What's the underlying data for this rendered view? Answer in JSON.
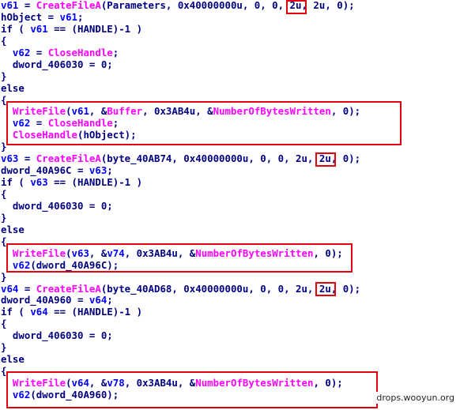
{
  "code_lines": [
    [
      {
        "t": "v61",
        "c": "v"
      },
      {
        "t": " = ",
        "c": "k"
      },
      {
        "t": "CreateFileA",
        "c": "f"
      },
      {
        "t": "(Parameters, 0x40000000u, 0, 0, 2u, 2u, 0);",
        "c": "k"
      }
    ],
    [
      {
        "t": "hObject = ",
        "c": "k"
      },
      {
        "t": "v61",
        "c": "v"
      },
      {
        "t": ";",
        "c": "k"
      }
    ],
    [
      {
        "t": "if ( ",
        "c": "k"
      },
      {
        "t": "v61",
        "c": "v"
      },
      {
        "t": " == (HANDLE)-1 )",
        "c": "k"
      }
    ],
    [
      {
        "t": "{",
        "c": "k"
      }
    ],
    [
      {
        "t": "  ",
        "c": "k"
      },
      {
        "t": "v62",
        "c": "v"
      },
      {
        "t": " = ",
        "c": "k"
      },
      {
        "t": "CloseHandle",
        "c": "f"
      },
      {
        "t": ";",
        "c": "k"
      }
    ],
    [
      {
        "t": "  dword_406030 = 0;",
        "c": "k"
      }
    ],
    [
      {
        "t": "}",
        "c": "k"
      }
    ],
    [
      {
        "t": "else",
        "c": "k"
      }
    ],
    [
      {
        "t": "{",
        "c": "k"
      }
    ],
    [
      {
        "t": "  ",
        "c": "k"
      },
      {
        "t": "WriteFile",
        "c": "f"
      },
      {
        "t": "(",
        "c": "k"
      },
      {
        "t": "v61",
        "c": "v"
      },
      {
        "t": ", &",
        "c": "k"
      },
      {
        "t": "Buffer",
        "c": "f"
      },
      {
        "t": ", 0x3AB4u, &",
        "c": "k"
      },
      {
        "t": "NumberOfBytesWritten",
        "c": "f"
      },
      {
        "t": ", 0);",
        "c": "k"
      }
    ],
    [
      {
        "t": "  ",
        "c": "k"
      },
      {
        "t": "v62",
        "c": "v"
      },
      {
        "t": " = ",
        "c": "k"
      },
      {
        "t": "CloseHandle",
        "c": "f"
      },
      {
        "t": ";",
        "c": "k"
      }
    ],
    [
      {
        "t": "  ",
        "c": "k"
      },
      {
        "t": "CloseHandle",
        "c": "f"
      },
      {
        "t": "(hObject);",
        "c": "k"
      }
    ],
    [
      {
        "t": "}",
        "c": "k"
      }
    ],
    [
      {
        "t": "v63",
        "c": "v"
      },
      {
        "t": " = ",
        "c": "k"
      },
      {
        "t": "CreateFileA",
        "c": "f"
      },
      {
        "t": "(byte_40AB74, 0x40000000u, 0, 0, 2u, 2u, 0);",
        "c": "k"
      }
    ],
    [
      {
        "t": "dword_40A96C = ",
        "c": "k"
      },
      {
        "t": "v63",
        "c": "v"
      },
      {
        "t": ";",
        "c": "k"
      }
    ],
    [
      {
        "t": "if ( ",
        "c": "k"
      },
      {
        "t": "v63",
        "c": "v"
      },
      {
        "t": " == (HANDLE)-1 )",
        "c": "k"
      }
    ],
    [
      {
        "t": "{",
        "c": "k"
      }
    ],
    [
      {
        "t": "  dword_406030 = 0;",
        "c": "k"
      }
    ],
    [
      {
        "t": "}",
        "c": "k"
      }
    ],
    [
      {
        "t": "else",
        "c": "k"
      }
    ],
    [
      {
        "t": "{",
        "c": "k"
      }
    ],
    [
      {
        "t": "  ",
        "c": "k"
      },
      {
        "t": "WriteFile",
        "c": "f"
      },
      {
        "t": "(",
        "c": "k"
      },
      {
        "t": "v63",
        "c": "v"
      },
      {
        "t": ", &",
        "c": "k"
      },
      {
        "t": "v74",
        "c": "v"
      },
      {
        "t": ", 0x3AB4u, &",
        "c": "k"
      },
      {
        "t": "NumberOfBytesWritten",
        "c": "f"
      },
      {
        "t": ", 0);",
        "c": "k"
      }
    ],
    [
      {
        "t": "  ",
        "c": "k"
      },
      {
        "t": "v62",
        "c": "v"
      },
      {
        "t": "(dword_40A96C);",
        "c": "k"
      }
    ],
    [
      {
        "t": "}",
        "c": "k"
      }
    ],
    [
      {
        "t": "v64",
        "c": "v"
      },
      {
        "t": " = ",
        "c": "k"
      },
      {
        "t": "CreateFileA",
        "c": "f"
      },
      {
        "t": "(byte_40AD68, 0x40000000u, 0, 0, 2u, 2u, 0);",
        "c": "k"
      }
    ],
    [
      {
        "t": "dword_40A960 = ",
        "c": "k"
      },
      {
        "t": "v64",
        "c": "v"
      },
      {
        "t": ";",
        "c": "k"
      }
    ],
    [
      {
        "t": "if ( ",
        "c": "k"
      },
      {
        "t": "v64",
        "c": "v"
      },
      {
        "t": " == (HANDLE)-1 )",
        "c": "k"
      }
    ],
    [
      {
        "t": "{",
        "c": "k"
      }
    ],
    [
      {
        "t": "  dword_406030 = 0;",
        "c": "k"
      }
    ],
    [
      {
        "t": "}",
        "c": "k"
      }
    ],
    [
      {
        "t": "else",
        "c": "k"
      }
    ],
    [
      {
        "t": "{",
        "c": "k"
      }
    ],
    [
      {
        "t": "  ",
        "c": "k"
      },
      {
        "t": "WriteFile",
        "c": "f"
      },
      {
        "t": "(",
        "c": "k"
      },
      {
        "t": "v64",
        "c": "v"
      },
      {
        "t": ", &",
        "c": "k"
      },
      {
        "t": "v78",
        "c": "v"
      },
      {
        "t": ", 0x3AB4u, &",
        "c": "k"
      },
      {
        "t": "NumberOfBytesWritten",
        "c": "f"
      },
      {
        "t": ", 0);",
        "c": "k"
      }
    ],
    [
      {
        "t": "  ",
        "c": "k"
      },
      {
        "t": "v62",
        "c": "v"
      },
      {
        "t": "(dword_40A960);",
        "c": "k"
      }
    ]
  ],
  "watermark": "drops.wooyun.org",
  "colors": {
    "default": "#000080",
    "variable": "#0000ff",
    "function": "#ff00ff",
    "highlight_box": "#e0000f"
  }
}
